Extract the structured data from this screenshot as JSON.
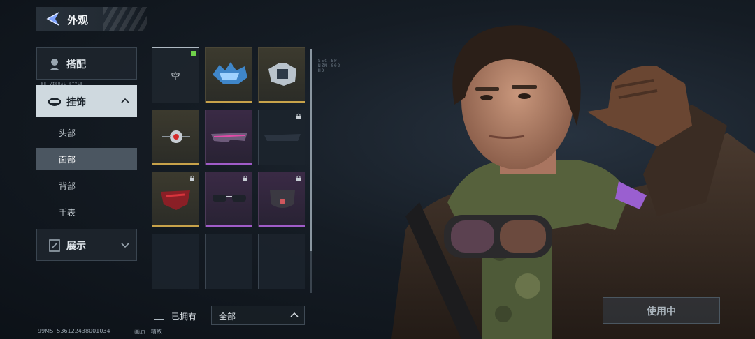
{
  "header": {
    "title": "外观",
    "back_icon": "back-arrow-icon"
  },
  "sidebar": {
    "tabs": [
      {
        "label": "搭配",
        "icon": "wardrobe-icon",
        "micro": ""
      },
      {
        "label": "挂饰",
        "icon": "mask-icon",
        "micro": "BE VISUAL STYLE",
        "expanded": true
      },
      {
        "label": "展示",
        "icon": "display-icon",
        "micro": ""
      }
    ],
    "sub_items": [
      {
        "label": "头部"
      },
      {
        "label": "面部",
        "selected": true
      },
      {
        "label": "背部"
      },
      {
        "label": "手表"
      }
    ]
  },
  "grid": {
    "empty_label": "空",
    "items": [
      {
        "name": "empty",
        "rarity": "none",
        "locked": false,
        "equipped": true
      },
      {
        "name": "blue-crystal-mask",
        "rarity": "gold",
        "locked": false
      },
      {
        "name": "tech-armor-mask",
        "rarity": "gold",
        "locked": false
      },
      {
        "name": "cyber-eye-monocle",
        "rarity": "gold",
        "locked": false
      },
      {
        "name": "purple-visor",
        "rarity": "purple",
        "locked": false
      },
      {
        "name": "dark-visor",
        "rarity": "gold",
        "locked": true
      },
      {
        "name": "red-face-mask",
        "rarity": "gold",
        "locked": true
      },
      {
        "name": "sunglasses",
        "rarity": "purple",
        "locked": true
      },
      {
        "name": "cloth-face-mask",
        "rarity": "purple",
        "locked": true
      }
    ],
    "side_code": [
      "SEC.SP",
      "NZM.002",
      "HD"
    ]
  },
  "filters": {
    "owned_label": "已拥有",
    "owned_checked": false,
    "category_value": "全部"
  },
  "status": {
    "ping": "99MS",
    "uid": "536122438001034",
    "quality_label": "画质:",
    "quality_value": "精致"
  },
  "action": {
    "use_label": "使用中"
  },
  "colors": {
    "gold": "#c7a24a",
    "purple": "#a05cc8",
    "equipped": "#6fd14a",
    "panel_active": "#cfd9df"
  }
}
